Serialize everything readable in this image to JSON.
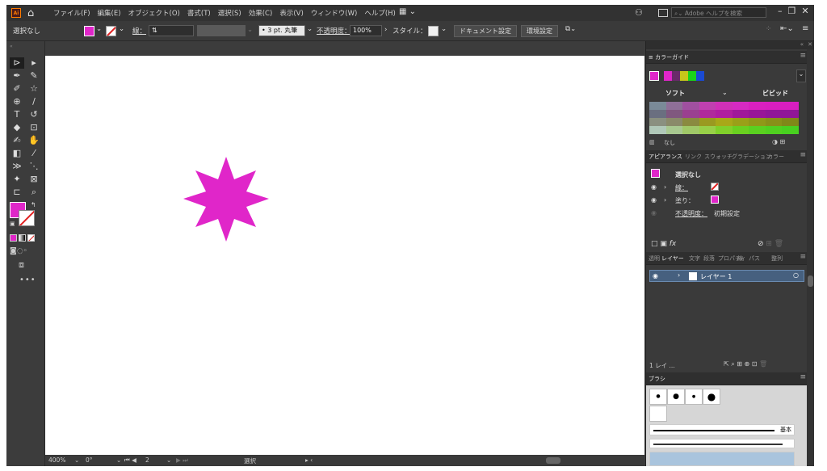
{
  "menubar": {
    "logo": "Ai",
    "menus": [
      "ファイル(F)",
      "編集(E)",
      "オブジェクト(O)",
      "書式(T)",
      "選択(S)",
      "効果(C)",
      "表示(V)",
      "ウィンドウ(W)",
      "ヘルプ(H)"
    ],
    "search_placeholder": "Adobe ヘルプを検索"
  },
  "control": {
    "selection": "選択なし",
    "stroke_label": "線：",
    "stroke_value": "3 pt. 丸筆",
    "opacity_label": "不透明度：",
    "opacity_value": "100%",
    "style_label": "スタイル：",
    "doc_settings": "ドキュメント設定",
    "preferences": "環境設定"
  },
  "colors": {
    "fill": "#e026c9",
    "accent": "#46607f"
  },
  "color_guide": {
    "tab": "カラーガイド",
    "soft": "ソフト",
    "vivid": "ビビッド",
    "footer_label": "なし",
    "harmony_swatches": [
      "#e026c9",
      "#6a2a6a",
      "#c6c61a",
      "#1ad31a",
      "#1a4ad3"
    ],
    "grid": [
      [
        "#7a8a98",
        "#8f6f98",
        "#a050a0",
        "#c040b0",
        "#d030b8",
        "#d62ac2",
        "#d820c0",
        "#d81ec0",
        "#d81ec0"
      ],
      [
        "#6a6f80",
        "#80587f",
        "#9a4090",
        "#b02a9c",
        "#b01ea0",
        "#a0189a",
        "#981698",
        "#901698",
        "#901698"
      ],
      [
        "#8a9080",
        "#8a8a6a",
        "#8a8a40",
        "#9a9a20",
        "#a8a818",
        "#9aa018",
        "#909818",
        "#889018",
        "#808818"
      ],
      [
        "#b0c8b8",
        "#a8c890",
        "#a0c868",
        "#98d048",
        "#80d02a",
        "#6ad020",
        "#5ad020",
        "#50d020",
        "#48d020"
      ]
    ]
  },
  "appearance": {
    "tabs": [
      "アピアランス",
      "リンク",
      "スウォッチ",
      "グラデーション",
      "カラー"
    ],
    "title": "選択なし",
    "stroke_label": "線：",
    "fill_label": "塗り：",
    "opacity_label": "不透明度：",
    "opacity_value": "初期設定"
  },
  "layers": {
    "tabs": [
      "透明",
      "レイヤー",
      "文字",
      "段落",
      "プロパティ",
      "線",
      "パス",
      "整列"
    ],
    "layer_name": "レイヤー 1",
    "footer_count": "1 レイ ..."
  },
  "brushes": {
    "tab": "ブラシ",
    "basic_label": "基本"
  },
  "status": {
    "zoom": "400%",
    "rotation": "0°",
    "artboard": "2",
    "tool": "選択"
  }
}
